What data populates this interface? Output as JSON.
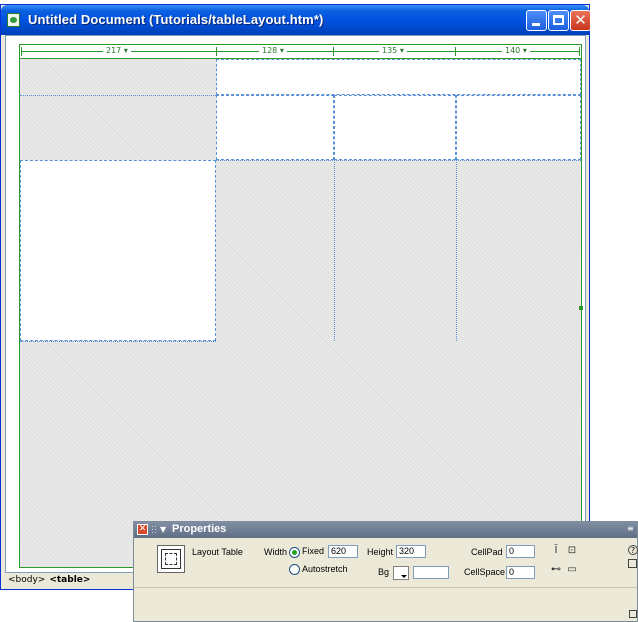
{
  "window": {
    "title": "Untitled Document (Tutorials/tableLayout.htm*)",
    "icon": "dreamweaver-document-icon",
    "controls": [
      "minimize-icon",
      "maximize-icon",
      "close-icon"
    ]
  },
  "layout_table": {
    "column_widths": [
      "217 ▾",
      "128 ▾",
      "135 ▾",
      "140 ▾"
    ],
    "border_color": "#2a9b2a",
    "guide_color": "#5b8fd6"
  },
  "status_bar": {
    "tags": [
      "<body>",
      "<table>"
    ]
  },
  "properties": {
    "title": "Properties",
    "object_label": "Layout Table",
    "width_label": "Width",
    "fixed_label": "Fixed",
    "fixed_value": "620",
    "autostretch_label": "Autostretch",
    "height_label": "Height",
    "height_value": "320",
    "bg_label": "Bg",
    "bg_value": "",
    "cellpad_label": "CellPad",
    "cellpad_value": "0",
    "cellspace_label": "CellSpace",
    "cellspace_value": "0",
    "width_mode": "fixed"
  }
}
